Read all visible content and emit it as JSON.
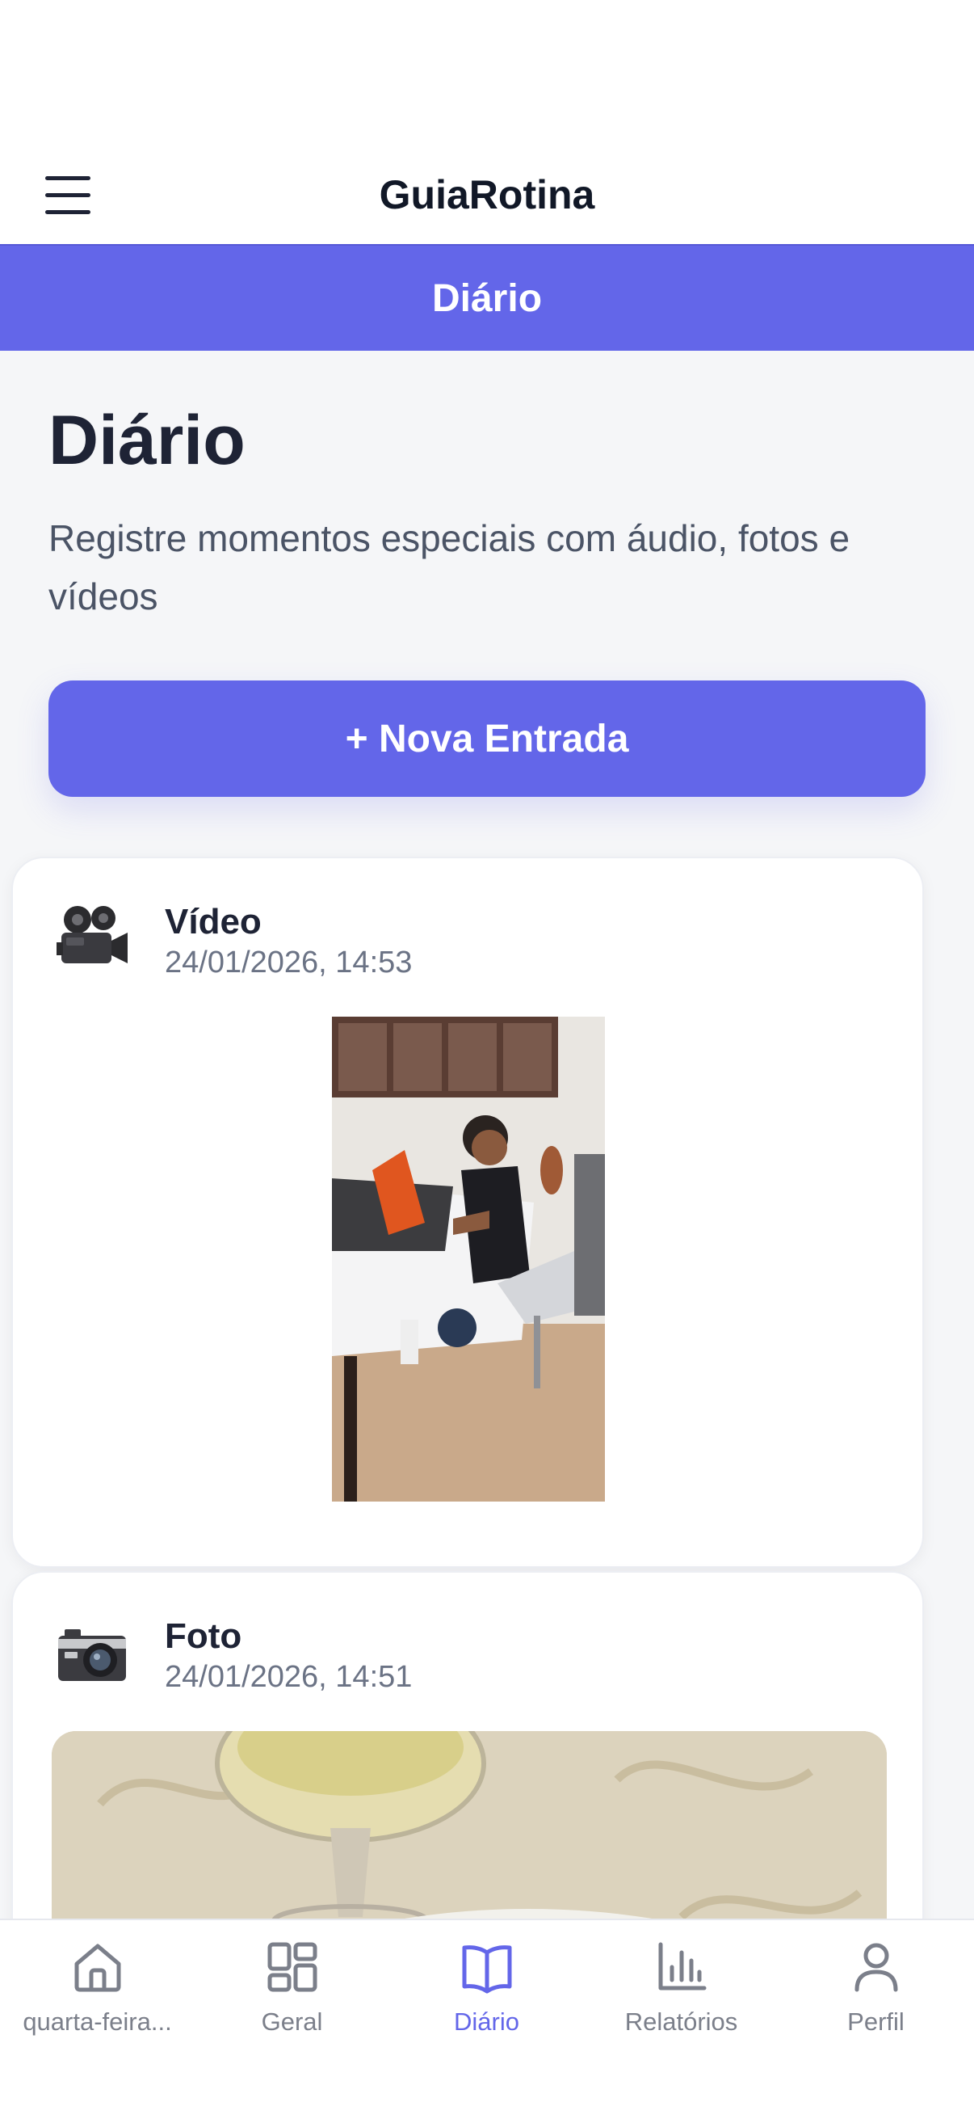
{
  "header": {
    "app_title": "GuiaRotina",
    "menu_icon": "hamburger-menu-icon"
  },
  "section_bar": {
    "title": "Diário"
  },
  "page": {
    "title": "Diário",
    "subtitle": "Registre momentos especiais com áudio, fotos e vídeos",
    "new_entry_label": "+ Nova Entrada"
  },
  "entries": [
    {
      "type": "Vídeo",
      "date": "24/01/2026, 14:53",
      "icon": "movie-camera-icon"
    },
    {
      "type": "Foto",
      "date": "24/01/2026, 14:51",
      "icon": "camera-icon"
    }
  ],
  "tabs": [
    {
      "label": "quarta-feira...",
      "icon": "home-icon"
    },
    {
      "label": "Geral",
      "icon": "grid-icon"
    },
    {
      "label": "Diário",
      "icon": "book-icon",
      "active": true
    },
    {
      "label": "Relatórios",
      "icon": "bar-chart-icon"
    },
    {
      "label": "Perfil",
      "icon": "user-icon"
    }
  ],
  "colors": {
    "accent": "#6366e9",
    "text_dark": "#1e2335",
    "text_muted": "#6b7385",
    "tab_inactive": "#7b7f8a"
  }
}
